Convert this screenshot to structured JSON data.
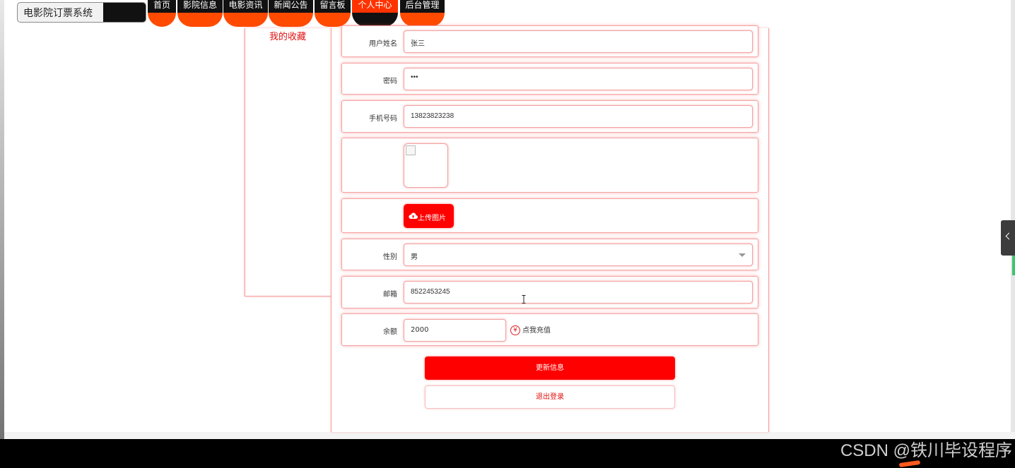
{
  "app": {
    "title": "电影院订票系统"
  },
  "nav": {
    "items": [
      {
        "label": "首页"
      },
      {
        "label": "影院信息"
      },
      {
        "label": "电影资讯"
      },
      {
        "label": "新闻公告"
      },
      {
        "label": "留言板"
      },
      {
        "label": "个人中心",
        "active": true
      },
      {
        "label": "后台管理"
      }
    ]
  },
  "sidebar": {
    "favorites_label": "我的收藏"
  },
  "form": {
    "username": {
      "label": "用户姓名",
      "value": "张三"
    },
    "password": {
      "label": "密码",
      "value": "•••"
    },
    "phone": {
      "label": "手机号码",
      "value": "13823823238"
    },
    "avatar": {
      "upload_label": "上传图片"
    },
    "gender": {
      "label": "性别",
      "value": "男"
    },
    "email": {
      "label": "邮箱",
      "value": "8522453245"
    },
    "balance": {
      "label": "余额",
      "value": "2000",
      "recharge_label": "点我充值",
      "currency_symbol": "¥"
    },
    "update_button": "更新信息",
    "logout_button": "退出登录"
  },
  "colors": {
    "accent": "#ff0000",
    "nav_orange": "#ff4a00",
    "border_pink": "#f4a4a4"
  },
  "watermark": "CSDN @铁川毕设程序"
}
